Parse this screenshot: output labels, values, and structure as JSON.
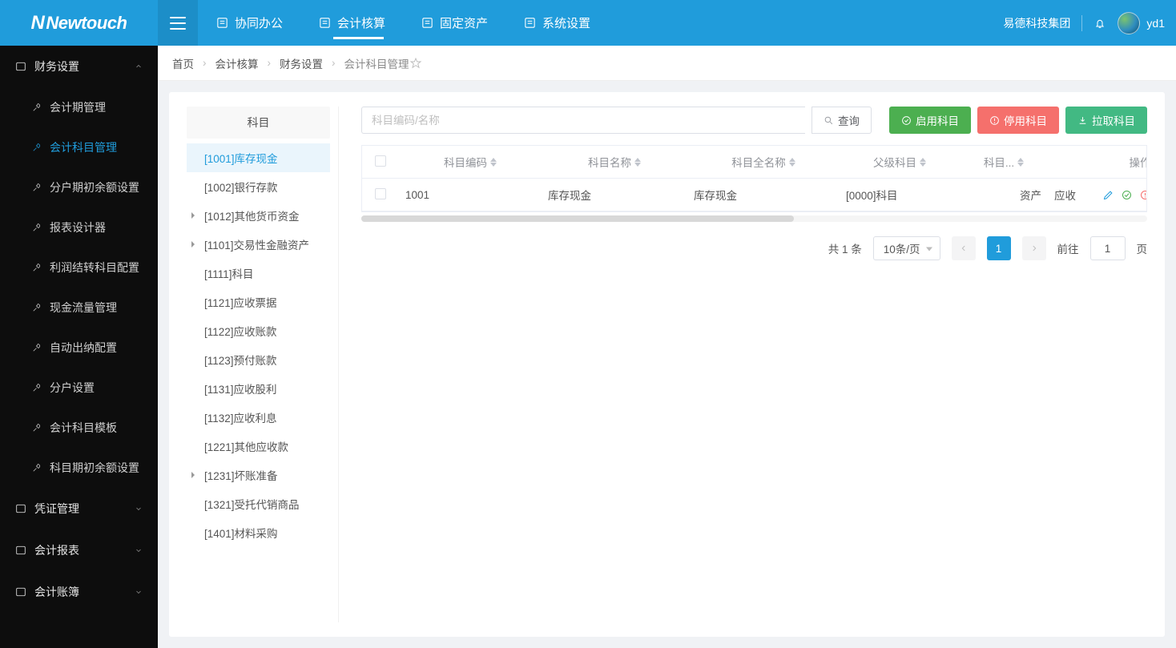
{
  "brand": "Newtouch",
  "topnav": {
    "items": [
      {
        "label": "协同办公"
      },
      {
        "label": "会计核算",
        "active": true
      },
      {
        "label": "固定资产"
      },
      {
        "label": "系统设置"
      }
    ]
  },
  "top_right": {
    "org": "易德科技集团",
    "username": "yd1"
  },
  "breadcrumb": {
    "items": [
      "首页",
      "会计核算",
      "财务设置",
      "会计科目管理"
    ]
  },
  "sidebar": {
    "groups": [
      {
        "label": "财务设置",
        "expanded": true,
        "items": [
          {
            "label": "会计期管理"
          },
          {
            "label": "会计科目管理",
            "active": true
          },
          {
            "label": "分户期初余额设置"
          },
          {
            "label": "报表设计器"
          },
          {
            "label": "利润结转科目配置"
          },
          {
            "label": "现金流量管理"
          },
          {
            "label": "自动出纳配置"
          },
          {
            "label": "分户设置"
          },
          {
            "label": "会计科目模板"
          },
          {
            "label": "科目期初余额设置"
          }
        ]
      },
      {
        "label": "凭证管理",
        "expanded": false
      },
      {
        "label": "会计报表",
        "expanded": false
      },
      {
        "label": "会计账簿",
        "expanded": false
      }
    ]
  },
  "tree": {
    "title": "科目",
    "items": [
      {
        "label": "[1001]库存现金",
        "selected": true
      },
      {
        "label": "[1002]银行存款"
      },
      {
        "label": "[1012]其他货币资金",
        "has_children": true
      },
      {
        "label": "[1101]交易性金融资产",
        "has_children": true
      },
      {
        "label": "[1111]科目"
      },
      {
        "label": "[1121]应收票据"
      },
      {
        "label": "[1122]应收账款"
      },
      {
        "label": "[1123]预付账款"
      },
      {
        "label": "[1131]应收股利"
      },
      {
        "label": "[1132]应收利息"
      },
      {
        "label": "[1221]其他应收款"
      },
      {
        "label": "[1231]坏账准备",
        "has_children": true
      },
      {
        "label": "[1321]受托代销商品"
      },
      {
        "label": "[1401]材料采购"
      }
    ]
  },
  "toolbar": {
    "search_placeholder": "科目编码/名称",
    "btn_search": "查询",
    "btn_enable": "启用科目",
    "btn_disable": "停用科目",
    "btn_pull": "拉取科目"
  },
  "table": {
    "columns": [
      "科目编码",
      "科目名称",
      "科目全名称",
      "父级科目",
      "科目...",
      "",
      "操作"
    ],
    "rows": [
      {
        "code": "1001",
        "name": "库存现金",
        "fullname": "库存现金",
        "parent": "[0000]科目",
        "type": "资产",
        "extra": "应收"
      }
    ]
  },
  "pagination": {
    "total_text": "共 1 条",
    "page_size": "10条/页",
    "current": "1",
    "goto_label_pre": "前往",
    "goto_value": "1",
    "goto_label_post": "页"
  }
}
